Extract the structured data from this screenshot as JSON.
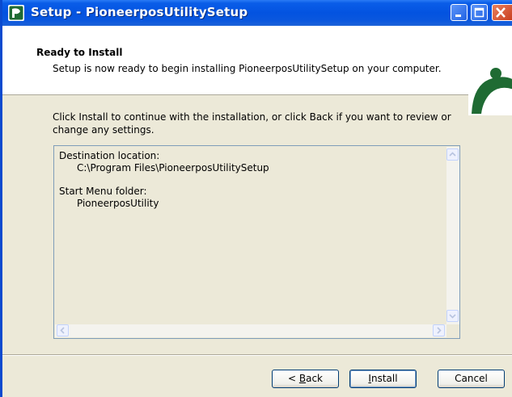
{
  "window": {
    "title": "Setup - PioneerposUtilitySetup"
  },
  "header": {
    "title": "Ready to Install",
    "subtitle": "Setup is now ready to begin installing PioneerposUtilitySetup on your computer."
  },
  "body": {
    "intro": "Click Install to continue with the installation, or click Back if you want to review or change any settings.",
    "memo": {
      "destination_label": "Destination location:",
      "destination_value": "C:\\Program Files\\PioneerposUtilitySetup",
      "startmenu_label": "Start Menu folder:",
      "startmenu_value": "PioneerposUtility"
    }
  },
  "buttons": {
    "back_prefix": "< ",
    "back_accel": "B",
    "back_rest": "ack",
    "install_accel": "I",
    "install_rest": "nstall",
    "cancel": "Cancel"
  },
  "colors": {
    "titlebar": "#0353E0",
    "logo_green": "#1F6B33",
    "dialog_bg": "#ECE9D8"
  },
  "icons": {
    "app": "setup-app-icon",
    "minimize": "minimize-icon",
    "maximize": "maximize-icon",
    "close": "close-icon",
    "logo": "pioneerpos-logo"
  }
}
